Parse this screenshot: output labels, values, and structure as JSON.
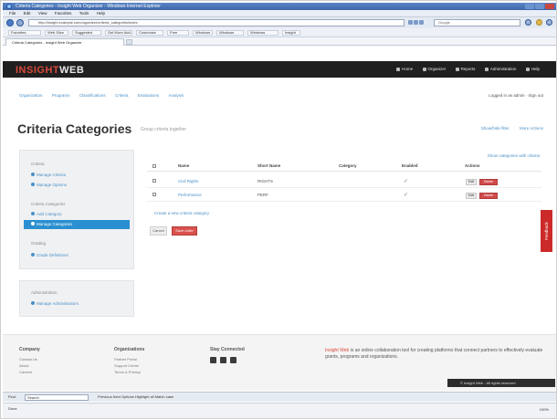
{
  "window": {
    "title": "Criteria Categories - Insight Web Organizer - Windows Internet Explorer"
  },
  "menubar": [
    "File",
    "Edit",
    "View",
    "Favorites",
    "Tools",
    "Help"
  ],
  "address_bar": {
    "url": "http://insight.example.com/organizer/criteria_categories/index",
    "search_placeholder": "Google"
  },
  "favorites_bar": [
    "Favorites",
    "Web Slice Gallery",
    "Suggested Sites",
    "Get More Add-ons",
    "Customize Links",
    "Free Hotmail",
    "Windows",
    "Windows Media",
    "Windows Marketplace",
    "Insight"
  ],
  "tabs": [
    {
      "label": "Criteria Categories - Insight Web Organizer"
    }
  ],
  "site": {
    "logo_part1": "INSIGHT",
    "logo_part2": "WEB",
    "nav": [
      "Home",
      "Organizer",
      "Reports",
      "Administration",
      "Help"
    ]
  },
  "breadcrumbs": [
    "Organization",
    "Programs",
    "Classifications",
    "Criteria",
    "Evaluations",
    "Analysis"
  ],
  "user_status": "Logged in as admin · Sign out",
  "page": {
    "title": "Criteria Categories",
    "subtitle": "Group criteria together",
    "title_links": [
      "Show/hide filter",
      "More Actions"
    ]
  },
  "sidebar": {
    "card1": {
      "section1": "Criteria",
      "links1": [
        "Manage Criteria",
        "Manage Options"
      ],
      "section2": "Criteria Categories",
      "links2": [
        "Add Category",
        "Manage Categories"
      ],
      "section3": "Grading",
      "links3": [
        "Grade Definitions"
      ]
    },
    "card2": {
      "section": "Administration",
      "links": [
        "Manage Administrators"
      ]
    }
  },
  "table": {
    "top_link": "Show categories with criteria",
    "headers": [
      "Name",
      "Short Name",
      "Category",
      "Enabled",
      "Actions"
    ],
    "rows": [
      {
        "name": "Civil Rights",
        "short_name": "RIGHTS",
        "category": "",
        "enabled": true
      },
      {
        "name": "Performance",
        "short_name": "PERF",
        "category": "",
        "enabled": true
      }
    ],
    "edit_label": "Edit",
    "delete_label": "Delete",
    "add_link": "Create a new criteria category",
    "btn_secondary": "Cancel",
    "btn_primary": "Save order"
  },
  "feedback_label": "Feedback",
  "footer": {
    "col1": {
      "heading": "Company",
      "items": [
        "Contact Us",
        "About",
        "Careers"
      ]
    },
    "col2": {
      "heading": "Organizations",
      "items": [
        "Partner Portal",
        "Support Center",
        "Terms & Privacy"
      ]
    },
    "col3": {
      "heading": "Stay Connected"
    },
    "blurb_brand": "Insight Web",
    "blurb_rest": " is an online collaboration tool for creating platforms that connect partners to effectively evaluate grants, programs and organizations.",
    "dark_bar": "© Insight Web - All rights reserved"
  },
  "find_bar": {
    "label": "Find:",
    "value": "Search",
    "options": "Previous  Next  Options  Highlight all  Match case"
  },
  "status_bar": {
    "text": "Done",
    "zoom": "100%"
  }
}
